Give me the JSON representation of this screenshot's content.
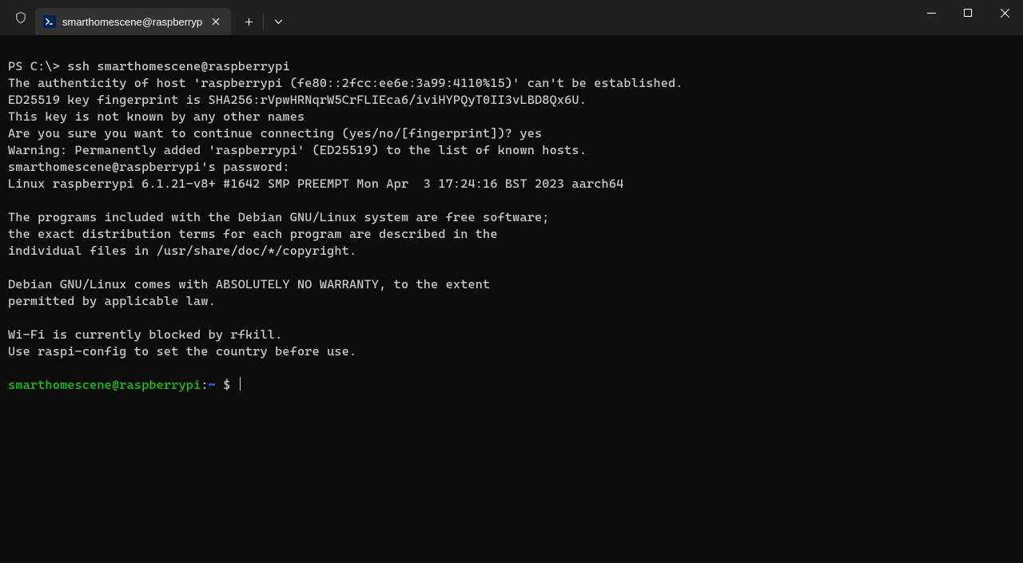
{
  "tab": {
    "title": "smarthomescene@raspberryp",
    "icon": "powershell-icon"
  },
  "terminal": {
    "lines": [
      {
        "type": "cmd",
        "prompt": "PS C:\\> ",
        "text": "ssh smarthomescene@raspberrypi"
      },
      {
        "type": "out",
        "text": "The authenticity of host 'raspberrypi (fe80::2fcc:ee6e:3a99:4110%15)' can't be established."
      },
      {
        "type": "out",
        "text": "ED25519 key fingerprint is SHA256:rVpwHRNqrW5CrFLIEca6/iviHYPQyT0II3vLBD8Qx6U."
      },
      {
        "type": "out",
        "text": "This key is not known by any other names"
      },
      {
        "type": "out",
        "text": "Are you sure you want to continue connecting (yes/no/[fingerprint])? yes"
      },
      {
        "type": "out",
        "text": "Warning: Permanently added 'raspberrypi' (ED25519) to the list of known hosts."
      },
      {
        "type": "out",
        "text": "smarthomescene@raspberrypi's password:"
      },
      {
        "type": "out",
        "text": "Linux raspberrypi 6.1.21-v8+ #1642 SMP PREEMPT Mon Apr  3 17:24:16 BST 2023 aarch64"
      },
      {
        "type": "out",
        "text": ""
      },
      {
        "type": "out",
        "text": "The programs included with the Debian GNU/Linux system are free software;"
      },
      {
        "type": "out",
        "text": "the exact distribution terms for each program are described in the"
      },
      {
        "type": "out",
        "text": "individual files in /usr/share/doc/*/copyright."
      },
      {
        "type": "out",
        "text": ""
      },
      {
        "type": "out",
        "text": "Debian GNU/Linux comes with ABSOLUTELY NO WARRANTY, to the extent"
      },
      {
        "type": "out",
        "text": "permitted by applicable law."
      },
      {
        "type": "out",
        "text": ""
      },
      {
        "type": "out",
        "text": "Wi-Fi is currently blocked by rfkill."
      },
      {
        "type": "out",
        "text": "Use raspi-config to set the country before use."
      },
      {
        "type": "out",
        "text": ""
      }
    ],
    "bash_prompt": {
      "user_host": "smarthomescene@raspberrypi",
      "colon": ":",
      "path": "~",
      "dollar": " $ "
    }
  }
}
